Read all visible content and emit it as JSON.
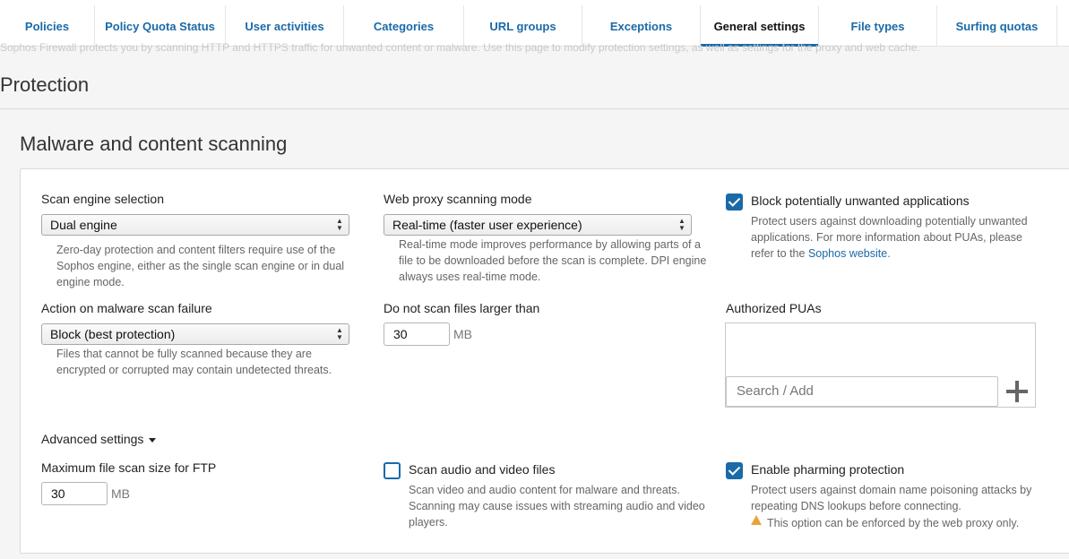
{
  "tabs": [
    {
      "label": "Policies"
    },
    {
      "label": "Policy Quota Status"
    },
    {
      "label": "User activities"
    },
    {
      "label": "Categories"
    },
    {
      "label": "URL groups"
    },
    {
      "label": "Exceptions"
    },
    {
      "label": "General settings"
    },
    {
      "label": "File types"
    },
    {
      "label": "Surfing quotas"
    }
  ],
  "intro_text": "Sophos Firewall protects you by scanning HTTP and HTTPS traffic for unwanted content or malware. Use this page to modify protection settings, as well as settings for the proxy and web cache.",
  "page_title": "Protection",
  "section_title": "Malware and content scanning",
  "scan_engine": {
    "label": "Scan engine selection",
    "value": "Dual engine",
    "help": "Zero-day protection and content filters require use of the Sophos engine, either as the single scan engine or in dual engine mode."
  },
  "proxy_mode": {
    "label": "Web proxy scanning mode",
    "value": "Real-time (faster user experience)",
    "help": "Real-time mode improves performance by allowing parts of a file to be downloaded before the scan is complete. DPI engine always uses real-time mode."
  },
  "block_pua": {
    "label": "Block potentially unwanted applications",
    "checked": true,
    "help_prefix": "Protect users against downloading potentially unwanted applications. For more information about PUAs, please refer to the ",
    "help_link": "Sophos website",
    "help_suffix": "."
  },
  "malware_failure": {
    "label": "Action on malware scan failure",
    "value": "Block (best protection)",
    "help": "Files that cannot be fully scanned because they are encrypted or corrupted may contain undetected threats."
  },
  "max_scan": {
    "label": "Do not scan files larger than",
    "value": "30",
    "unit": "MB"
  },
  "authorized_puas": {
    "label": "Authorized PUAs",
    "placeholder": "Search / Add"
  },
  "advanced_settings": {
    "label": "Advanced settings"
  },
  "ftp_max": {
    "label": "Maximum file scan size for FTP",
    "value": "30",
    "unit": "MB"
  },
  "scan_av": {
    "label": "Scan audio and video files",
    "checked": false,
    "help": "Scan video and audio content for malware and threats. Scanning may cause issues with streaming audio and video players."
  },
  "pharming": {
    "label": "Enable pharming protection",
    "checked": true,
    "help": "Protect users against domain name poisoning attacks by repeating DNS lookups before connecting.",
    "warning": "This option can be enforced by the web proxy only."
  },
  "colors": {
    "accent": "#1a6aa8",
    "warning": "#e8a33d"
  }
}
